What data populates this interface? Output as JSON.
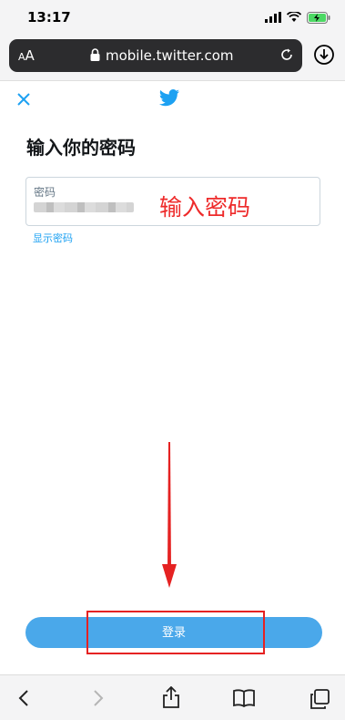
{
  "status_bar": {
    "time": "13:17"
  },
  "browser": {
    "text_size_label_small": "A",
    "text_size_label_large": "A",
    "url": "mobile.twitter.com"
  },
  "page": {
    "title": "输入你的密码",
    "password_label": "密码",
    "show_password": "显示密码",
    "login_button": "登录"
  },
  "annotation": {
    "text": "输入密码",
    "color": "#ee2a2a"
  },
  "colors": {
    "brand": "#1da1f2",
    "button": "#4aa8ea"
  }
}
